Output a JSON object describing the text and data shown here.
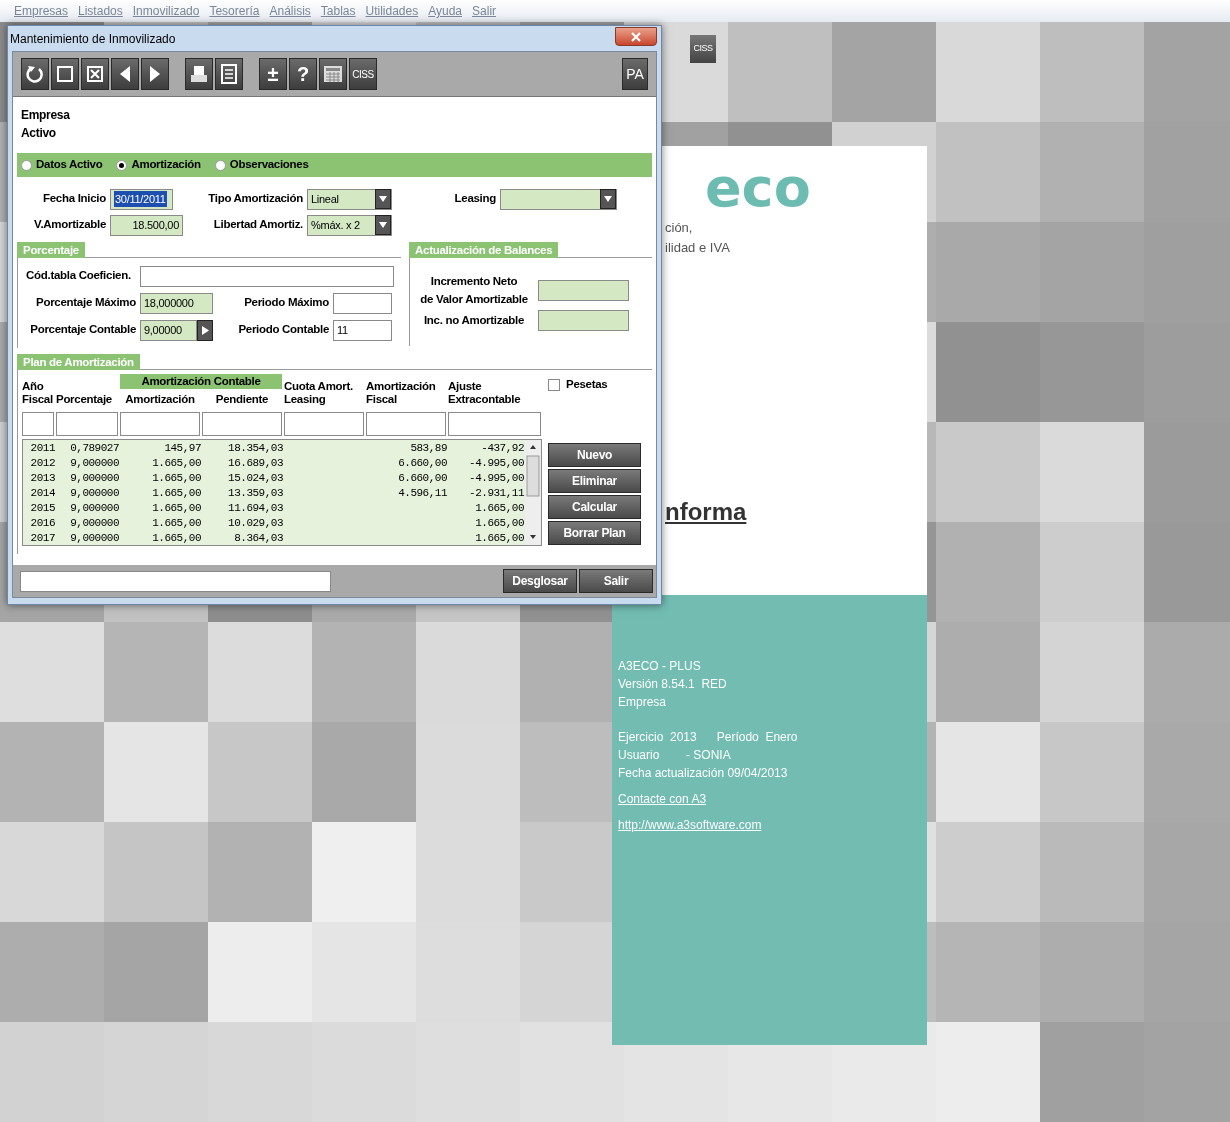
{
  "menu": [
    "Empresas",
    "Listados",
    "Inmovilizado",
    "Tesorería",
    "Análisis",
    "Tablas",
    "Utilidades",
    "Ayuda",
    "Salir"
  ],
  "desktop_button": "CISS",
  "splash": {
    "logo": "eco",
    "subtitle_lines": [
      "ción,",
      "ilidad e IVA"
    ],
    "heading": "nforma",
    "info_lines": [
      "A3ECO - PLUS",
      "Versión 8.54.1  RED",
      "Empresa"
    ],
    "session_lines": [
      "Ejercicio  2013      Período  Enero",
      "Usuario        - SONIA",
      "Fecha actualización 09/04/2013"
    ],
    "links": [
      "Contacte con A3",
      "http://www.a3software.com"
    ]
  },
  "dialog": {
    "title": "Mantenimiento de Inmovilizado",
    "toolbar_texts": {
      "plus_minus": "±",
      "help": "?",
      "ciss": "CISS",
      "profile": "PA"
    },
    "header_labels": [
      "Empresa",
      "Activo"
    ],
    "tabs": [
      {
        "label": "Datos Activo",
        "selected": false
      },
      {
        "label": "Amortización",
        "selected": true
      },
      {
        "label": "Observaciones",
        "selected": false
      }
    ],
    "fecha_inicio": {
      "label": "Fecha Inicio",
      "value": "30/11/2011"
    },
    "v_amortizable": {
      "label": "V.Amortizable",
      "value": "18.500,00"
    },
    "tipo_amortizacion": {
      "label": "Tipo Amortización",
      "value": "Lineal"
    },
    "libertad_amortiz": {
      "label": "Libertad Amortiz.",
      "value": "%máx. x 2"
    },
    "leasing": {
      "label": "Leasing"
    },
    "porcentaje": {
      "title": "Porcentaje",
      "cod_tabla": {
        "label": "Cód.tabla Coeficien."
      },
      "porcentaje_maximo": {
        "label": "Porcentaje Máximo",
        "value": "18,000000"
      },
      "periodo_maximo": {
        "label": "Periodo Máximo"
      },
      "porcentaje_contable": {
        "label": "Porcentaje Contable",
        "value": "9,00000"
      },
      "periodo_contable": {
        "label": "Periodo Contable",
        "value": "11"
      }
    },
    "actualizacion": {
      "title": "Actualización de Balances",
      "incremento_label": "Incremento Neto\nde Valor Amortizable",
      "inc_no_label": "Inc. no Amortizable"
    },
    "plan": {
      "title": "Plan de Amortización",
      "group_header": "Amortización Contable",
      "columns": [
        "Año\nFiscal",
        "Porcentaje",
        "Amortización",
        "Pendiente",
        "Cuota Amort.\nLeasing",
        "Amortización\nFiscal",
        "Ajuste\nExtracontable"
      ],
      "pesetas": {
        "label": "Pesetas",
        "checked": false
      },
      "rows": [
        {
          "year": "2011",
          "percent": "0,789027",
          "amortization": "145,97",
          "pending": "18.354,03",
          "fiscal": "583,89",
          "adjustment": "-437,92"
        },
        {
          "year": "2012",
          "percent": "9,000000",
          "amortization": "1.665,00",
          "pending": "16.689,03",
          "fiscal": "6.660,00",
          "adjustment": "-4.995,00"
        },
        {
          "year": "2013",
          "percent": "9,000000",
          "amortization": "1.665,00",
          "pending": "15.024,03",
          "fiscal": "6.660,00",
          "adjustment": "-4.995,00"
        },
        {
          "year": "2014",
          "percent": "9,000000",
          "amortization": "1.665,00",
          "pending": "13.359,03",
          "fiscal": "4.596,11",
          "adjustment": "-2.931,11"
        },
        {
          "year": "2015",
          "percent": "9,000000",
          "amortization": "1.665,00",
          "pending": "11.694,03",
          "adjustment": "1.665,00"
        },
        {
          "year": "2016",
          "percent": "9,000000",
          "amortization": "1.665,00",
          "pending": "10.029,03",
          "adjustment": "1.665,00"
        },
        {
          "year": "2017",
          "percent": "9,000000",
          "amortization": "1.665,00",
          "pending": "8.364,03",
          "adjustment": "1.665,00"
        }
      ],
      "buttons": [
        "Nuevo",
        "Eliminar",
        "Calcular",
        "Borrar Plan"
      ]
    },
    "footer_buttons": [
      "Desglosar",
      "Salir"
    ]
  }
}
